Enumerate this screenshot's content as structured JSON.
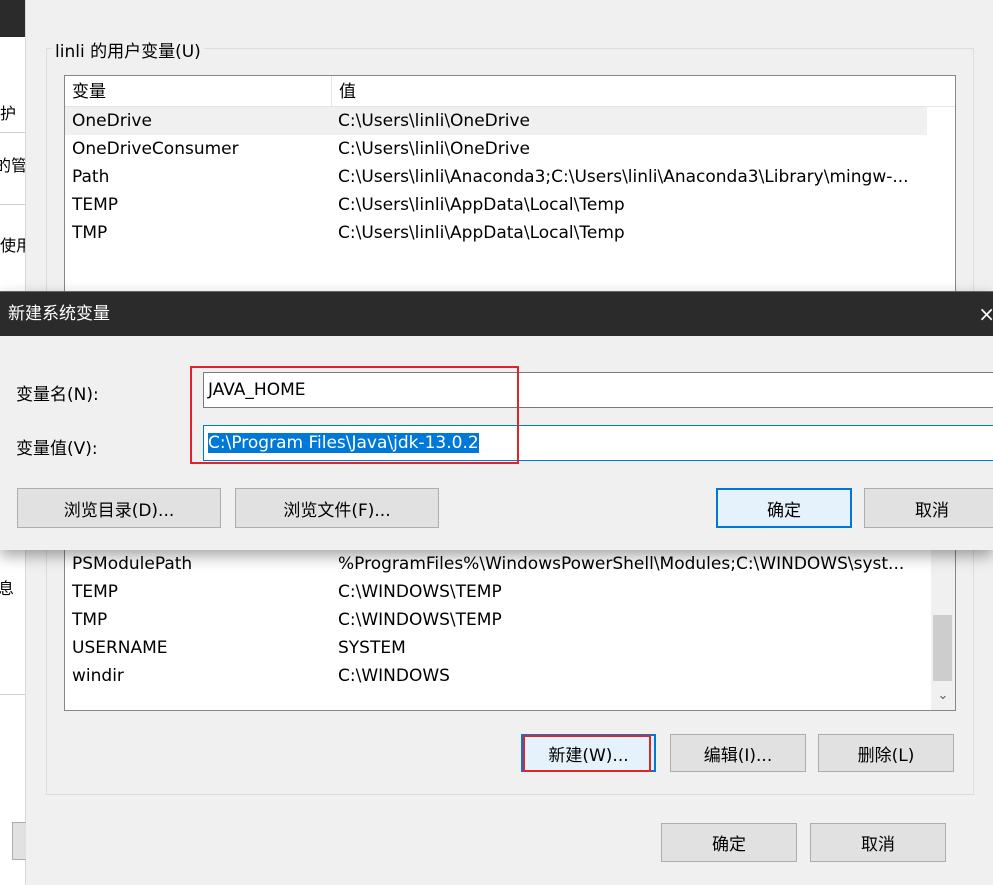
{
  "background_window": {
    "fragments": [
      "护",
      "的管",
      "使用",
      "息"
    ]
  },
  "env_dialog": {
    "user_group_label": "linli 的用户变量(U)",
    "user_table": {
      "columns": [
        "变量",
        "值"
      ],
      "rows": [
        {
          "name": "OneDrive",
          "value": "C:\\Users\\linli\\OneDrive"
        },
        {
          "name": "OneDriveConsumer",
          "value": "C:\\Users\\linli\\OneDrive"
        },
        {
          "name": "Path",
          "value": "C:\\Users\\linli\\Anaconda3;C:\\Users\\linli\\Anaconda3\\Library\\mingw-..."
        },
        {
          "name": "TEMP",
          "value": "C:\\Users\\linli\\AppData\\Local\\Temp"
        },
        {
          "name": "TMP",
          "value": "C:\\Users\\linli\\AppData\\Local\\Temp"
        }
      ]
    },
    "system_table": {
      "rows": [
        {
          "name": "PSModulePath",
          "value": "%ProgramFiles%\\WindowsPowerShell\\Modules;C:\\WINDOWS\\syst..."
        },
        {
          "name": "TEMP",
          "value": "C:\\WINDOWS\\TEMP"
        },
        {
          "name": "TMP",
          "value": "C:\\WINDOWS\\TEMP"
        },
        {
          "name": "USERNAME",
          "value": "SYSTEM"
        },
        {
          "name": "windir",
          "value": "C:\\WINDOWS"
        }
      ]
    },
    "system_buttons": {
      "new": "新建(W)...",
      "edit": "编辑(I)...",
      "delete": "删除(L)"
    },
    "footer_buttons": {
      "ok": "确定",
      "cancel": "取消"
    }
  },
  "new_var_dialog": {
    "title": "新建系统变量",
    "close_glyph": "×",
    "name_label": "变量名(N):",
    "name_value": "JAVA_HOME",
    "value_label": "变量值(V):",
    "value_value": "C:\\Program Files\\Java\\jdk-13.0.2",
    "browse_dir": "浏览目录(D)...",
    "browse_file": "浏览文件(F)...",
    "ok": "确定",
    "cancel": "取消"
  },
  "colors": {
    "highlight_red": "#e0252a",
    "titlebar": "#2b2b2b",
    "selection_blue": "#0078d7"
  }
}
